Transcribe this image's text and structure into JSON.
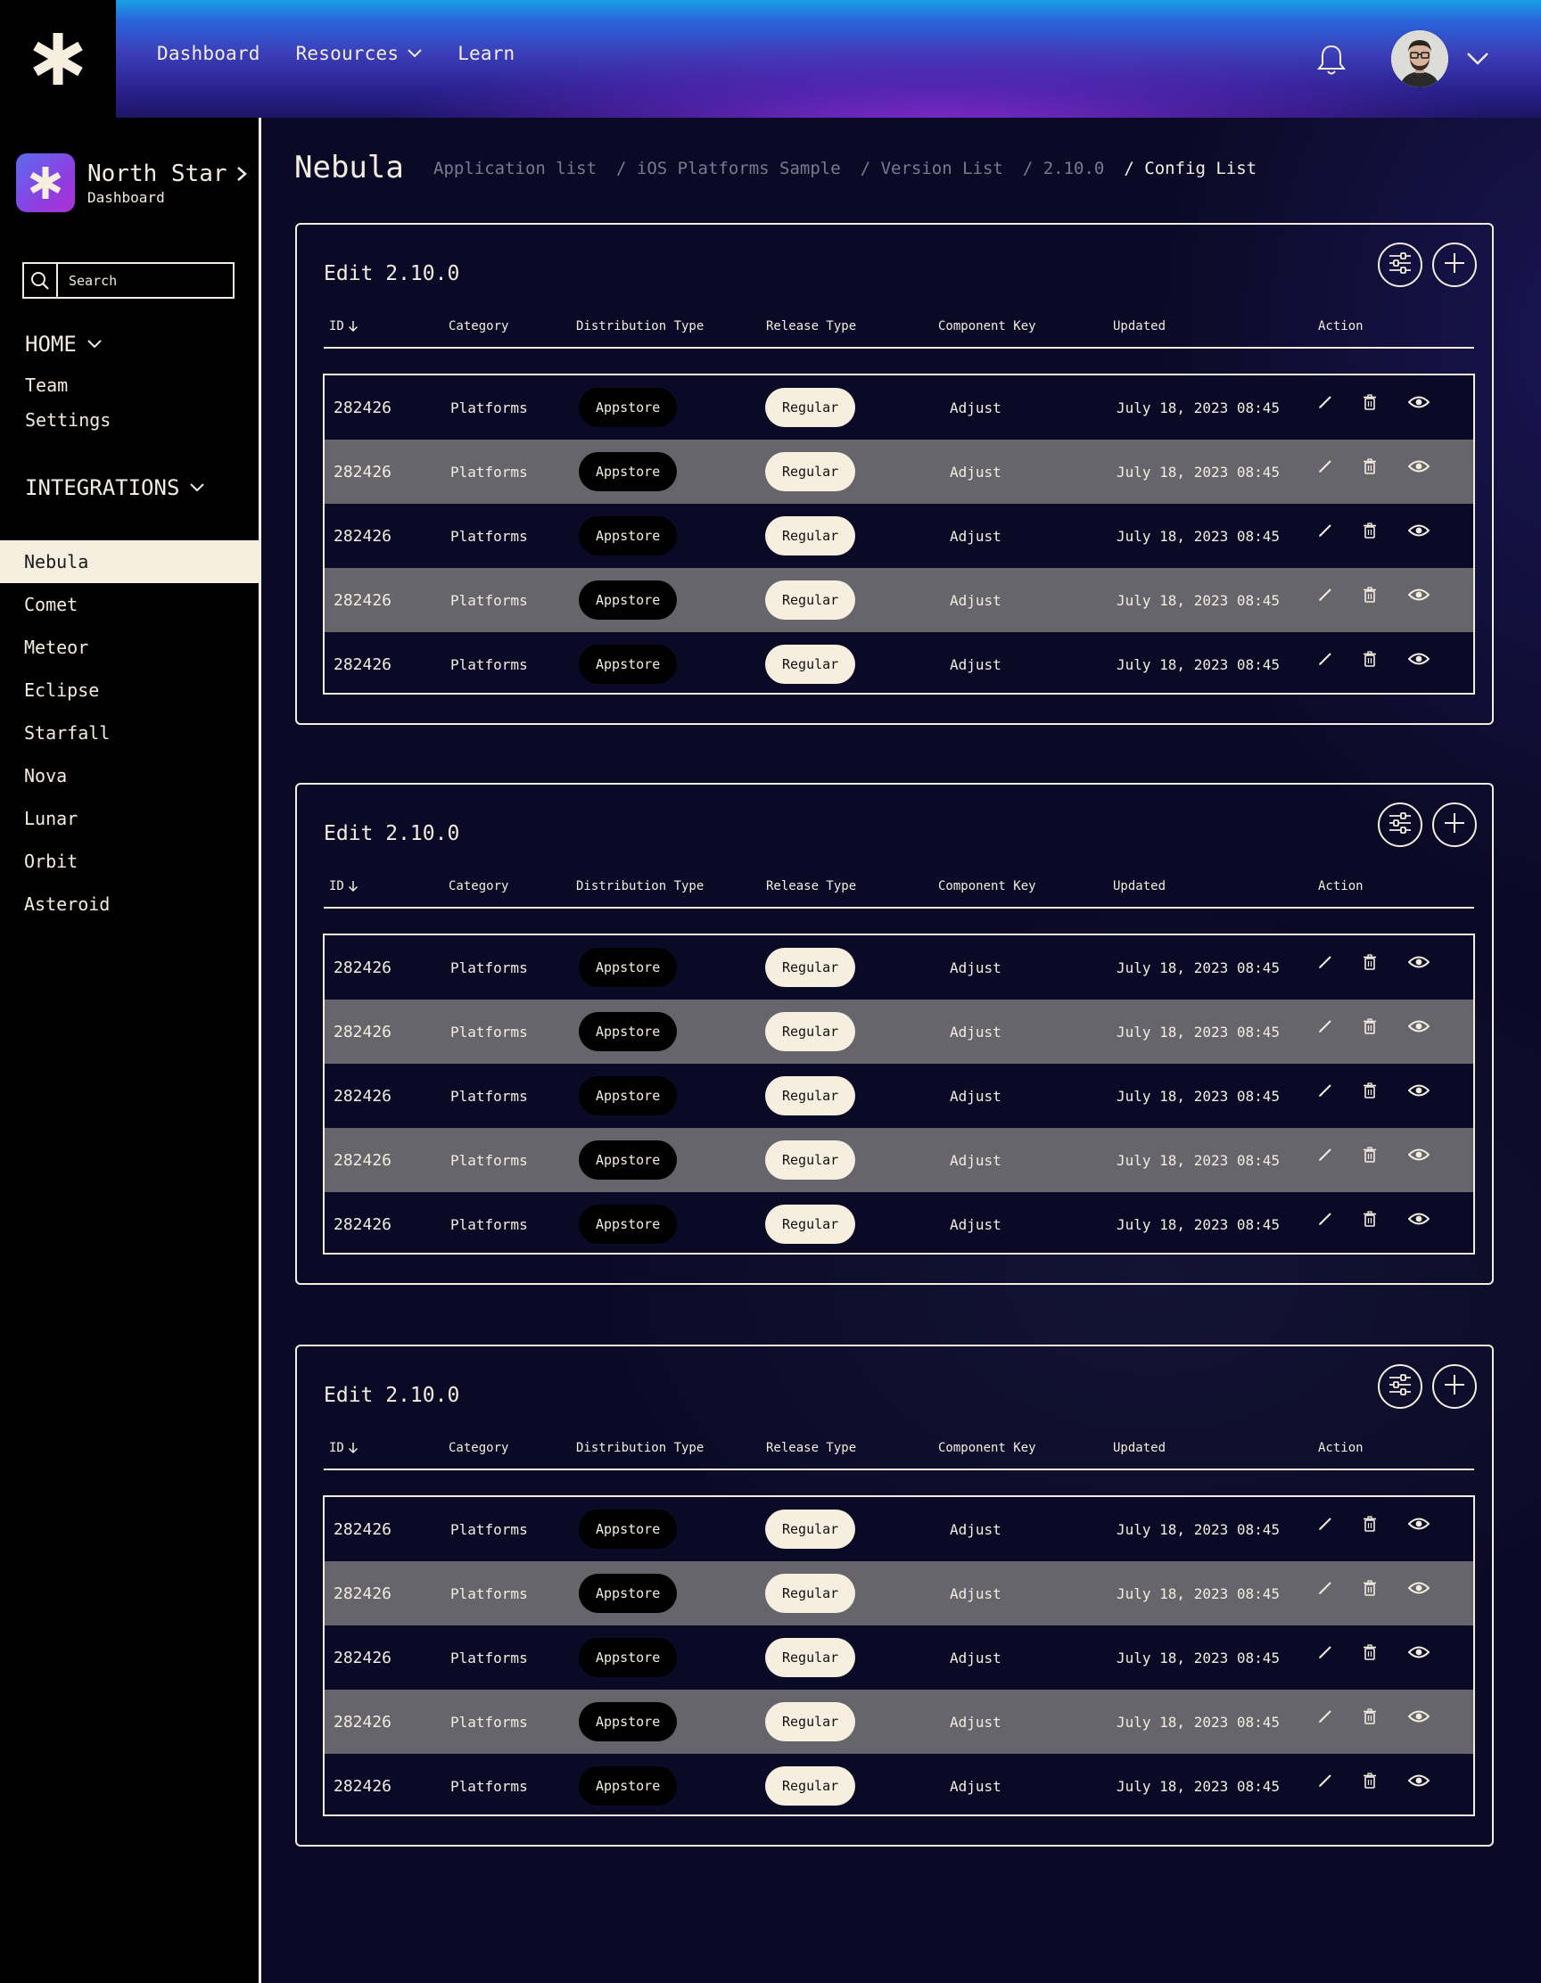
{
  "topbar": {
    "logo": "asterisk-logo",
    "nav": [
      {
        "label": "Dashboard",
        "has_dropdown": false
      },
      {
        "label": "Resources",
        "has_dropdown": true
      },
      {
        "label": "Learn",
        "has_dropdown": false
      }
    ],
    "icons": [
      "bell-icon",
      "avatar",
      "chevron-down-icon"
    ]
  },
  "sidebar": {
    "app": {
      "name": "North Star",
      "subtitle": "Dashboard"
    },
    "search": {
      "placeholder": "Search",
      "value": ""
    },
    "home": {
      "label": "HOME",
      "items": [
        "Team",
        "Settings"
      ]
    },
    "integrations": {
      "label": "INTEGRATIONS",
      "items": [
        "Nebula",
        "Comet",
        "Meteor",
        "Eclipse",
        "Starfall",
        "Nova",
        "Lunar",
        "Orbit",
        "Asteroid"
      ],
      "active": "Nebula"
    }
  },
  "page": {
    "title": "Nebula",
    "breadcrumb": [
      "Application list",
      "/ iOS Platforms Sample",
      "/ Version List",
      "/ 2.10.0",
      "/ Config List"
    ]
  },
  "table_headers": [
    "ID",
    "Category",
    "Distribution Type",
    "Release Type",
    "Component Key",
    "Updated",
    "Action"
  ],
  "sections": [
    {
      "title": "Edit 2.10.0",
      "rows": [
        {
          "id": "282426",
          "category": "Platforms",
          "distribution": "Appstore",
          "release": "Regular",
          "component": "Adjust",
          "updated": "July 18, 2023 08:45"
        },
        {
          "id": "282426",
          "category": "Platforms",
          "distribution": "Appstore",
          "release": "Regular",
          "component": "Adjust",
          "updated": "July 18, 2023 08:45"
        },
        {
          "id": "282426",
          "category": "Platforms",
          "distribution": "Appstore",
          "release": "Regular",
          "component": "Adjust",
          "updated": "July 18, 2023 08:45"
        },
        {
          "id": "282426",
          "category": "Platforms",
          "distribution": "Appstore",
          "release": "Regular",
          "component": "Adjust",
          "updated": "July 18, 2023 08:45"
        },
        {
          "id": "282426",
          "category": "Platforms",
          "distribution": "Appstore",
          "release": "Regular",
          "component": "Adjust",
          "updated": "July 18, 2023 08:45"
        }
      ]
    },
    {
      "title": "Edit 2.10.0",
      "rows": [
        {
          "id": "282426",
          "category": "Platforms",
          "distribution": "Appstore",
          "release": "Regular",
          "component": "Adjust",
          "updated": "July 18, 2023 08:45"
        },
        {
          "id": "282426",
          "category": "Platforms",
          "distribution": "Appstore",
          "release": "Regular",
          "component": "Adjust",
          "updated": "July 18, 2023 08:45"
        },
        {
          "id": "282426",
          "category": "Platforms",
          "distribution": "Appstore",
          "release": "Regular",
          "component": "Adjust",
          "updated": "July 18, 2023 08:45"
        },
        {
          "id": "282426",
          "category": "Platforms",
          "distribution": "Appstore",
          "release": "Regular",
          "component": "Adjust",
          "updated": "July 18, 2023 08:45"
        },
        {
          "id": "282426",
          "category": "Platforms",
          "distribution": "Appstore",
          "release": "Regular",
          "component": "Adjust",
          "updated": "July 18, 2023 08:45"
        }
      ]
    },
    {
      "title": "Edit 2.10.0",
      "rows": [
        {
          "id": "282426",
          "category": "Platforms",
          "distribution": "Appstore",
          "release": "Regular",
          "component": "Adjust",
          "updated": "July 18, 2023 08:45"
        },
        {
          "id": "282426",
          "category": "Platforms",
          "distribution": "Appstore",
          "release": "Regular",
          "component": "Adjust",
          "updated": "July 18, 2023 08:45"
        },
        {
          "id": "282426",
          "category": "Platforms",
          "distribution": "Appstore",
          "release": "Regular",
          "component": "Adjust",
          "updated": "July 18, 2023 08:45"
        },
        {
          "id": "282426",
          "category": "Platforms",
          "distribution": "Appstore",
          "release": "Regular",
          "component": "Adjust",
          "updated": "July 18, 2023 08:45"
        },
        {
          "id": "282426",
          "category": "Platforms",
          "distribution": "Appstore",
          "release": "Regular",
          "component": "Adjust",
          "updated": "July 18, 2023 08:45"
        }
      ]
    }
  ],
  "row_actions": [
    "pencil-icon",
    "trash-icon",
    "eye-icon"
  ],
  "card_actions": [
    "filter-sliders-icon",
    "plus-icon"
  ],
  "colors": {
    "accent_light": "#f6efe0",
    "row_grey": "#66656b",
    "background": "#0b0a26"
  }
}
